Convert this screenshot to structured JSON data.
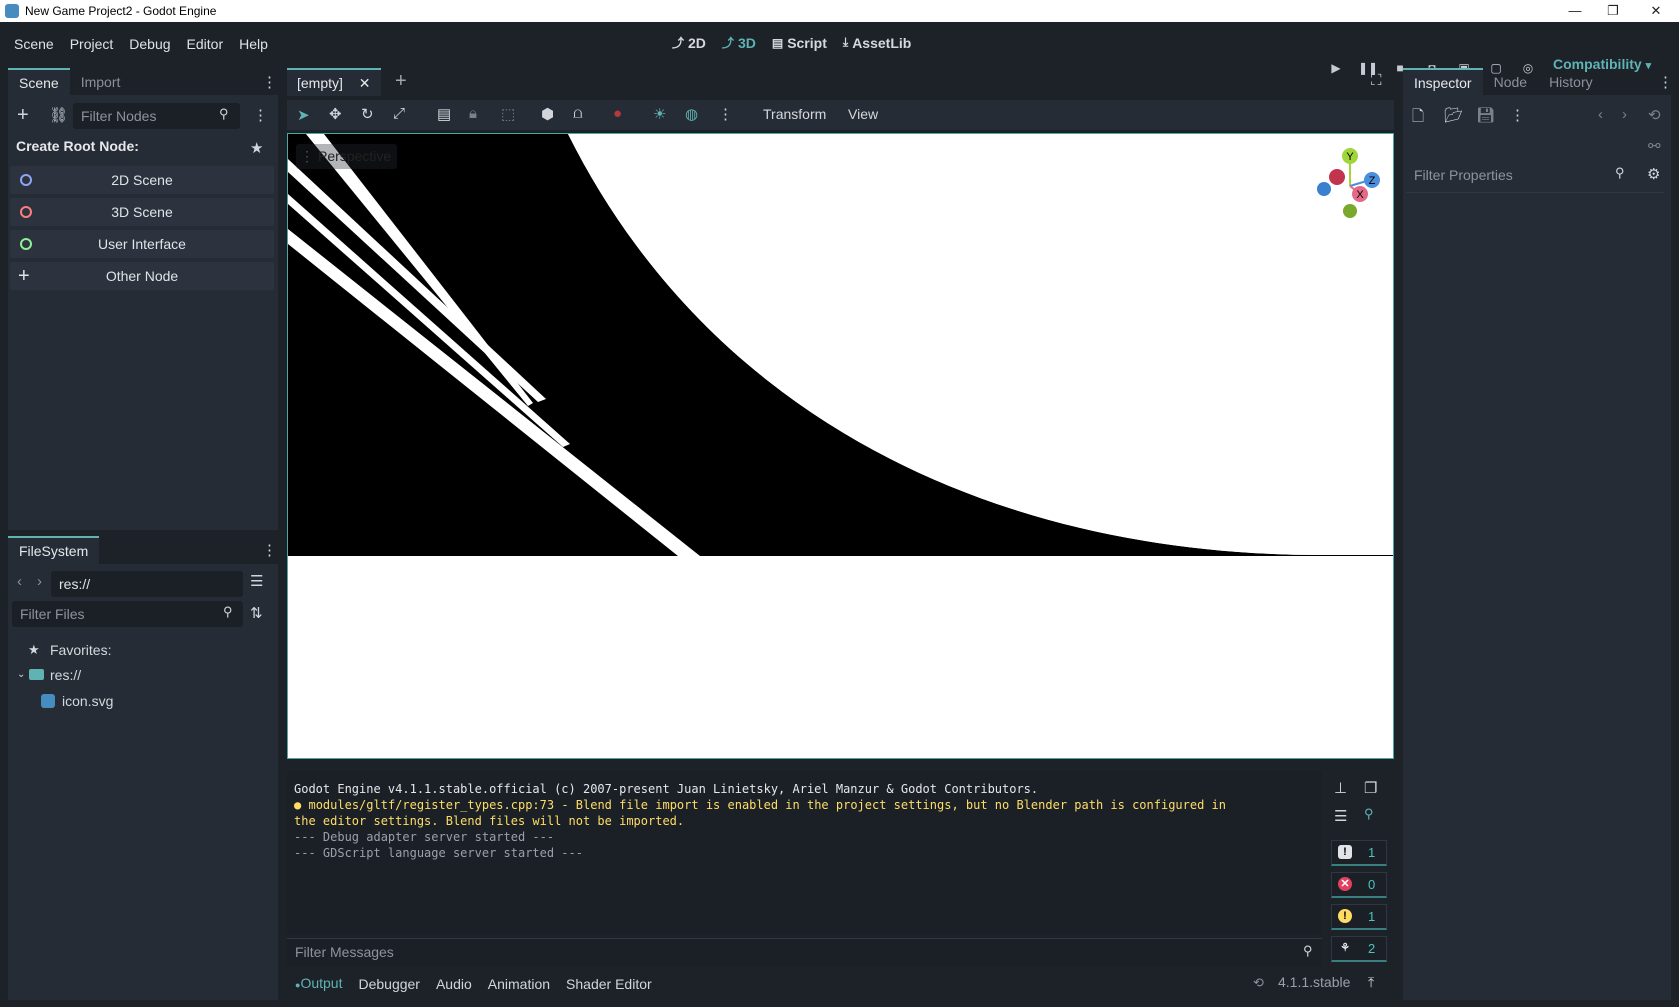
{
  "window": {
    "title": "New Game Project2 - Godot Engine",
    "minimize_icon": "—",
    "restore_icon": "❐",
    "close_icon": "✕"
  },
  "menubar": {
    "items": [
      "Scene",
      "Project",
      "Debug",
      "Editor",
      "Help"
    ],
    "workspaces": {
      "w2d": "2D",
      "w3d": "3D",
      "script": "Script",
      "assetlib": "AssetLib"
    },
    "renderer": "Compatibility"
  },
  "scene_dock": {
    "tabs": {
      "scene": "Scene",
      "import": "Import"
    },
    "filter_placeholder": "Filter Nodes",
    "create_root_label": "Create Root Node:",
    "root_nodes": {
      "n2d": "2D Scene",
      "n3d": "3D Scene",
      "ui": "User Interface",
      "other": "Other Node"
    }
  },
  "filesystem": {
    "tab": "FileSystem",
    "path": "res://",
    "filter_placeholder": "Filter Files",
    "favorites": "Favorites:",
    "root": "res://",
    "file": "icon.svg"
  },
  "editor": {
    "scene_tab": "[empty]",
    "toolbar_menus": {
      "transform": "Transform",
      "view": "View"
    },
    "viewport_label": "Perspective",
    "gizmo": {
      "y": "Y",
      "z": "Z",
      "x": "X"
    }
  },
  "inspector": {
    "tabs": {
      "inspector": "Inspector",
      "node": "Node",
      "history": "History"
    },
    "filter_placeholder": "Filter Properties"
  },
  "output": {
    "lines": {
      "l1": "Godot Engine v4.1.1.stable.official (c) 2007-present Juan Linietsky, Ariel Manzur & Godot Contributors.",
      "l2": "modules/gltf/register_types.cpp:73 - Blend file import is enabled in the project settings, but no Blender path is configured in",
      "l3": "the editor settings. Blend files will not be imported.",
      "l4": "--- Debug adapter server started ---",
      "l5": "--- GDScript language server started ---"
    },
    "filter_placeholder": "Filter Messages",
    "counts": {
      "messages": "1",
      "errors": "0",
      "warnings": "1",
      "editor": "2"
    }
  },
  "bottom_panel": {
    "tabs": {
      "output": "Output",
      "debugger": "Debugger",
      "audio": "Audio",
      "animation": "Animation",
      "shader": "Shader Editor"
    },
    "version": "4.1.1.stable"
  },
  "colors": {
    "accent": "#5fb3b3",
    "warning": "#ffdd65",
    "error": "#e0415e",
    "bg": "#1d2229",
    "panel": "#262c36"
  }
}
